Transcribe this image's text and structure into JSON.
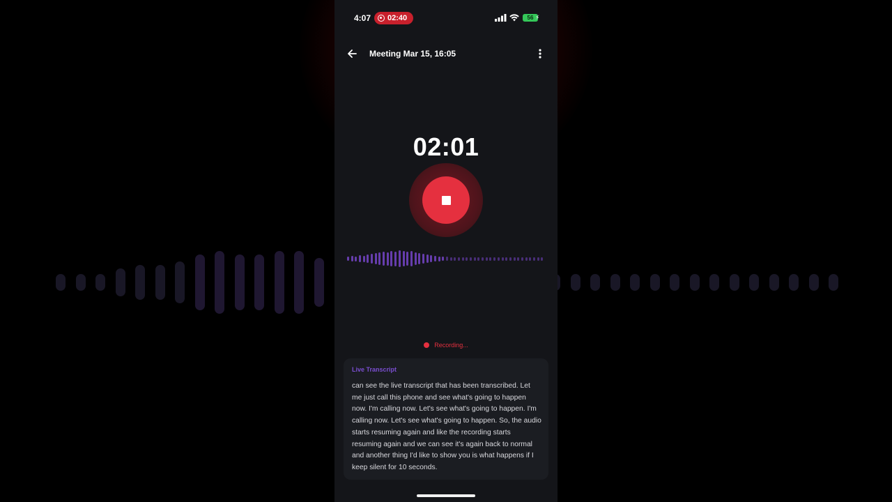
{
  "status_bar": {
    "time": "4:07",
    "recording_pill_time": "02:40",
    "battery": "56",
    "icons": [
      "record-icon",
      "signal-icon",
      "wifi-icon",
      "battery-icon",
      "bolt-icon"
    ]
  },
  "header": {
    "title": "Meeting Mar 15, 16:05",
    "back_icon": "arrow-left-icon",
    "menu_icon": "more-vertical-icon"
  },
  "recorder": {
    "elapsed": "02:01",
    "status": "Recording..."
  },
  "transcript": {
    "label": "Live Transcript",
    "text": "can see the live transcript that has been transcribed. Let me just call this phone and see what's going to happen now. I'm calling now. Let's see what's going to happen. I'm calling now. Let's see what's going to happen. So, the audio starts resuming again and like the recording starts resuming again and we can see it's again back to normal and another thing I'd like to show you is what happens if I keep silent for 10 seconds."
  },
  "colors": {
    "accent_red": "#e5303f",
    "accent_purple": "#7a4ed0",
    "panel_bg": "#141519",
    "card_bg": "#1b1d22"
  }
}
